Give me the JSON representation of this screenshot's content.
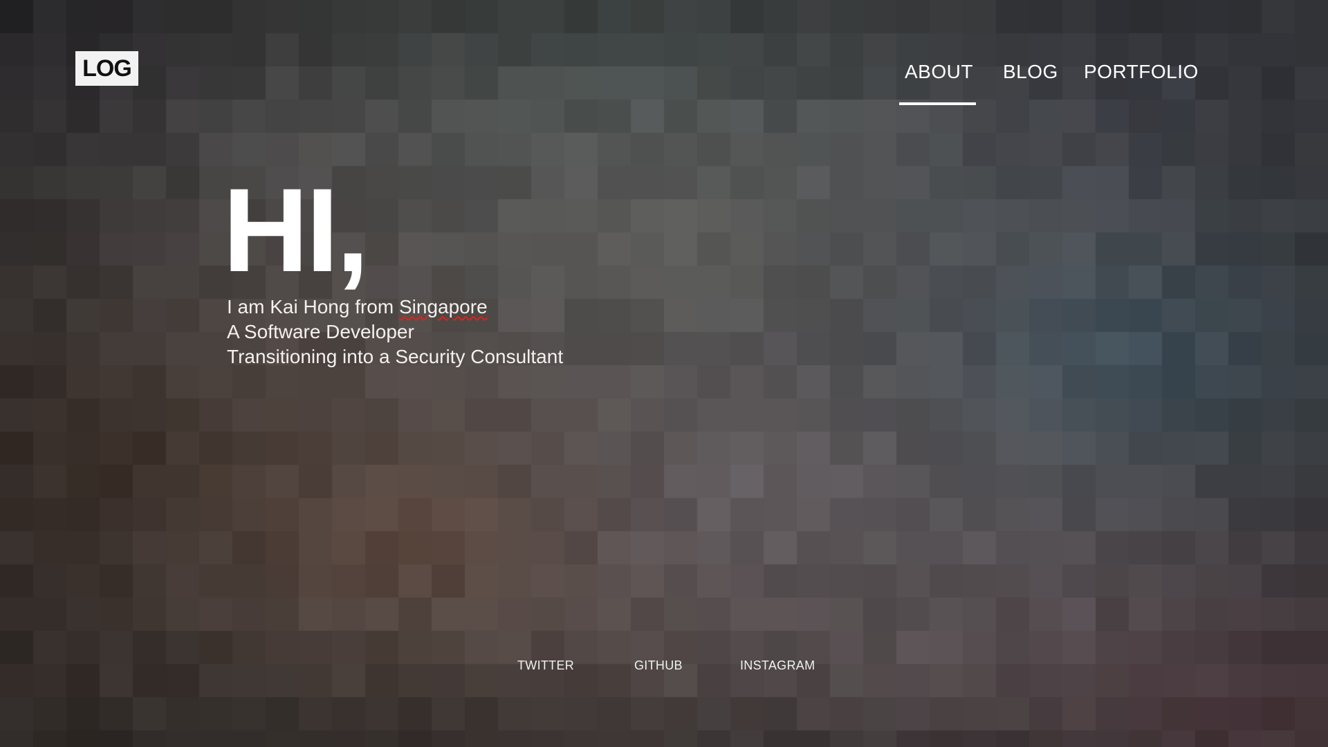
{
  "logo": {
    "text": "LOG"
  },
  "nav": {
    "items": [
      {
        "label": "ABOUT",
        "active": true
      },
      {
        "label": "BLOG",
        "active": false
      },
      {
        "label": "PORTFOLIO",
        "active": false
      }
    ]
  },
  "hero": {
    "greeting": "HI,",
    "intro_prefix": "I am Kai Hong from ",
    "intro_place": "Singapore",
    "line2": "A Software Developer",
    "line3": "Transitioning into a Security Consultant"
  },
  "social": {
    "links": [
      {
        "label": "TWITTER"
      },
      {
        "label": "GITHUB"
      },
      {
        "label": "INSTAGRAM"
      }
    ]
  },
  "colors": {
    "text": "#ffffff",
    "logo_background": "#f2f2f2",
    "logo_text": "#111111",
    "spellcheck_underline": "#e0211a",
    "background_base": "#4a4546"
  },
  "background": {
    "style": "pixelated-mosaic"
  }
}
